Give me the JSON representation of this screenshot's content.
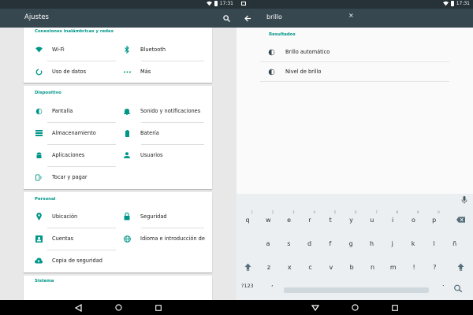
{
  "left": {
    "status": {
      "time": "17:31"
    },
    "toolbar": {
      "title": "Ajustes"
    },
    "sections": [
      {
        "title": "Conexiones inalámbricas y redes",
        "items": [
          {
            "label": "Wi-Fi",
            "icon": "wifi-icon"
          },
          {
            "label": "Bluetooth",
            "icon": "bluetooth-icon"
          },
          {
            "label": "Uso de datos",
            "icon": "data-usage-icon"
          },
          {
            "label": "Más",
            "icon": "more-icon"
          }
        ]
      },
      {
        "title": "Dispositivo",
        "items": [
          {
            "label": "Pantalla",
            "icon": "brightness-icon"
          },
          {
            "label": "Sonido y notificaciones",
            "icon": "bell-icon"
          },
          {
            "label": "Almacenamiento",
            "icon": "storage-icon"
          },
          {
            "label": "Batería",
            "icon": "battery-icon"
          },
          {
            "label": "Aplicaciones",
            "icon": "android-icon"
          },
          {
            "label": "Usuarios",
            "icon": "person-icon"
          },
          {
            "label": "Tocar y pagar",
            "icon": "nfc-icon"
          }
        ]
      },
      {
        "title": "Personal",
        "items": [
          {
            "label": "Ubicación",
            "icon": "location-icon"
          },
          {
            "label": "Seguridad",
            "icon": "lock-icon"
          },
          {
            "label": "Cuentas",
            "icon": "account-icon"
          },
          {
            "label": "Idioma e introducción de",
            "icon": "globe-icon"
          },
          {
            "label": "Copia de seguridad",
            "icon": "cloud-upload-icon"
          }
        ]
      },
      {
        "title": "Sistema"
      }
    ]
  },
  "right": {
    "status": {
      "time": "17:31"
    },
    "search": {
      "query": "brillo",
      "clear": "×"
    },
    "results": {
      "title": "Resultados",
      "items": [
        {
          "label": "Brillo automático"
        },
        {
          "label": "Nivel de brillo"
        }
      ]
    },
    "keyboard": {
      "row1": [
        "q",
        "w",
        "e",
        "r",
        "t",
        "y",
        "u",
        "i",
        "o",
        "p"
      ],
      "row1_hints": [
        "1",
        "2",
        "3",
        "4",
        "5",
        "6",
        "7",
        "8",
        "9",
        "0"
      ],
      "row2": [
        "a",
        "s",
        "d",
        "f",
        "g",
        "h",
        "j",
        "k",
        "l",
        "ñ"
      ],
      "row3": [
        "z",
        "x",
        "c",
        "v",
        "b",
        "n",
        "m",
        "!",
        "?"
      ],
      "symbols": "?123",
      "comma": ",",
      "period": "."
    }
  },
  "colors": {
    "accent": "#009688",
    "toolbar": "#37474f",
    "statusbar": "#263238"
  }
}
